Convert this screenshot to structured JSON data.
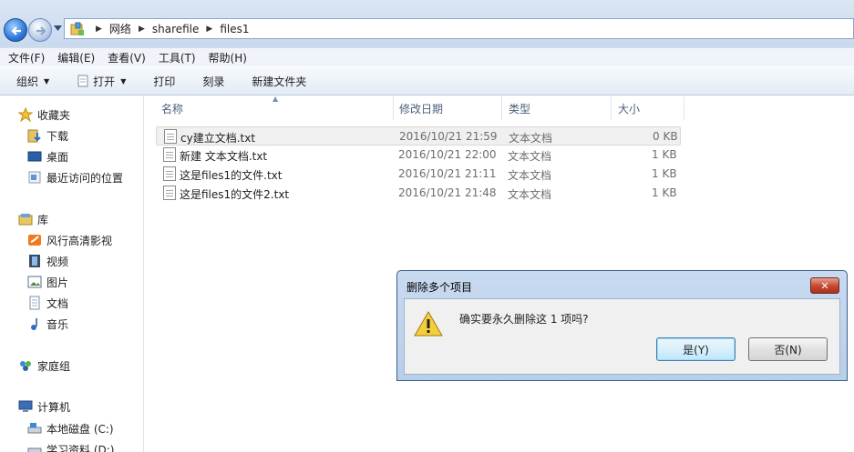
{
  "address": {
    "breadcrumbs": [
      "网络",
      "sharefile",
      "files1"
    ]
  },
  "menu": [
    "文件(F)",
    "编辑(E)",
    "查看(V)",
    "工具(T)",
    "帮助(H)"
  ],
  "toolbar": {
    "organize": "组织",
    "open": "打开",
    "print": "打印",
    "burn": "刻录",
    "new_folder": "新建文件夹"
  },
  "nav": {
    "favorites": "收藏夹",
    "downloads": "下载",
    "desktop": "桌面",
    "recent": "最近访问的位置",
    "libraries": "库",
    "fengxing": "风行高清影视",
    "videos": "视频",
    "pictures": "图片",
    "documents": "文档",
    "music": "音乐",
    "homegroup": "家庭组",
    "computer": "计算机",
    "local_disk": "本地磁盘 (C:)",
    "study": "学习资料 (D:)"
  },
  "columns": {
    "name": "名称",
    "modified": "修改日期",
    "type": "类型",
    "size": "大小"
  },
  "files": [
    {
      "name": "cy建立文档.txt",
      "modified": "2016/10/21 21:59",
      "type": "文本文档",
      "size": "0 KB"
    },
    {
      "name": "新建 文本文档.txt",
      "modified": "2016/10/21 22:00",
      "type": "文本文档",
      "size": "1 KB"
    },
    {
      "name": "这是files1的文件.txt",
      "modified": "2016/10/21 21:11",
      "type": "文本文档",
      "size": "1 KB"
    },
    {
      "name": "这是files1的文件2.txt",
      "modified": "2016/10/21 21:48",
      "type": "文本文档",
      "size": "1 KB"
    }
  ],
  "dialog": {
    "title": "删除多个项目",
    "message": "确实要永久删除这 1 项吗?",
    "yes": "是(Y)",
    "no": "否(N)"
  }
}
